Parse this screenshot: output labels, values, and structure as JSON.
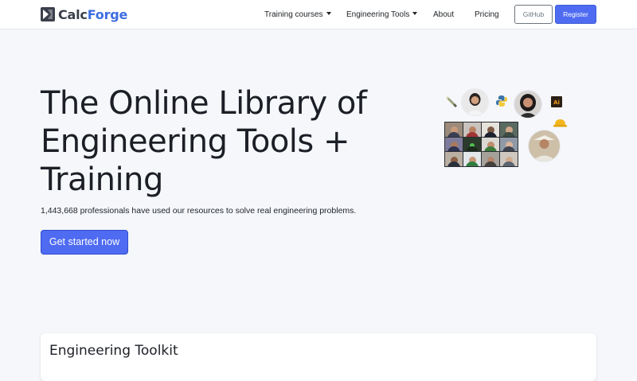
{
  "brand": {
    "name_prefix": "Calc",
    "name_accent": "Forge",
    "accent_color": "#3d6ee0"
  },
  "nav": {
    "training_courses": "Training courses",
    "engineering_tools": "Engineering Tools",
    "about": "About",
    "pricing": "Pricing",
    "github": "GitHub",
    "register": "Register"
  },
  "hero": {
    "title_line1": "The Online Library of",
    "title_line2": "Engineering Tools +",
    "title_line3": "Training",
    "subtitle": "1,443,668 professionals have used our resources to solve real engineering problems.",
    "cta": "Get started now",
    "cta_color": "#4e6bf2",
    "art_icons": [
      "paint-tube-icon",
      "python-logo-icon",
      "illustrator-logo-icon",
      "hard-hat-icon",
      "video-call-grid",
      "avatar-icon"
    ]
  },
  "toolkit": {
    "title": "Engineering Toolkit"
  },
  "colors": {
    "page_bg": "#f5f7fb",
    "primary": "#4e6bf2",
    "text": "#212529"
  }
}
